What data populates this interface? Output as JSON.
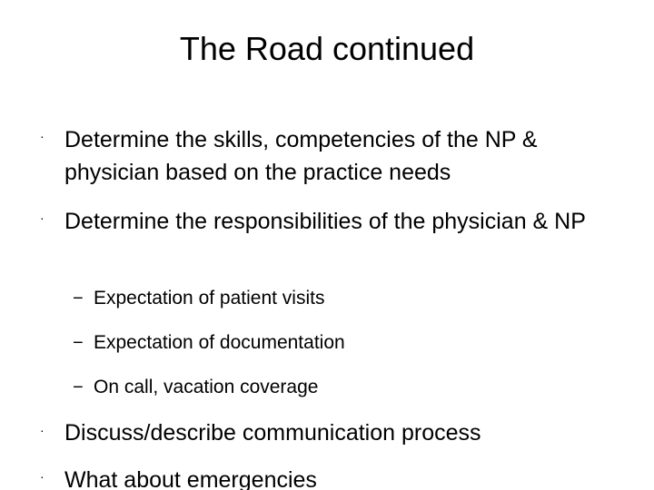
{
  "slide": {
    "title": "The Road continued",
    "bullets": [
      {
        "marker": "·",
        "text": "Determine the skills, competencies of the NP & physician based on the practice needs"
      },
      {
        "marker": "·",
        "text": "Determine the responsibilities of the physician & NP",
        "sub": [
          {
            "marker": "−",
            "text": "Expectation of patient visits"
          },
          {
            "marker": "−",
            "text": "Expectation of documentation"
          },
          {
            "marker": "−",
            "text": "On call, vacation coverage"
          }
        ]
      },
      {
        "marker": "·",
        "text": "Discuss/describe communication process"
      },
      {
        "marker": "·",
        "text": "What about emergencies"
      }
    ]
  }
}
